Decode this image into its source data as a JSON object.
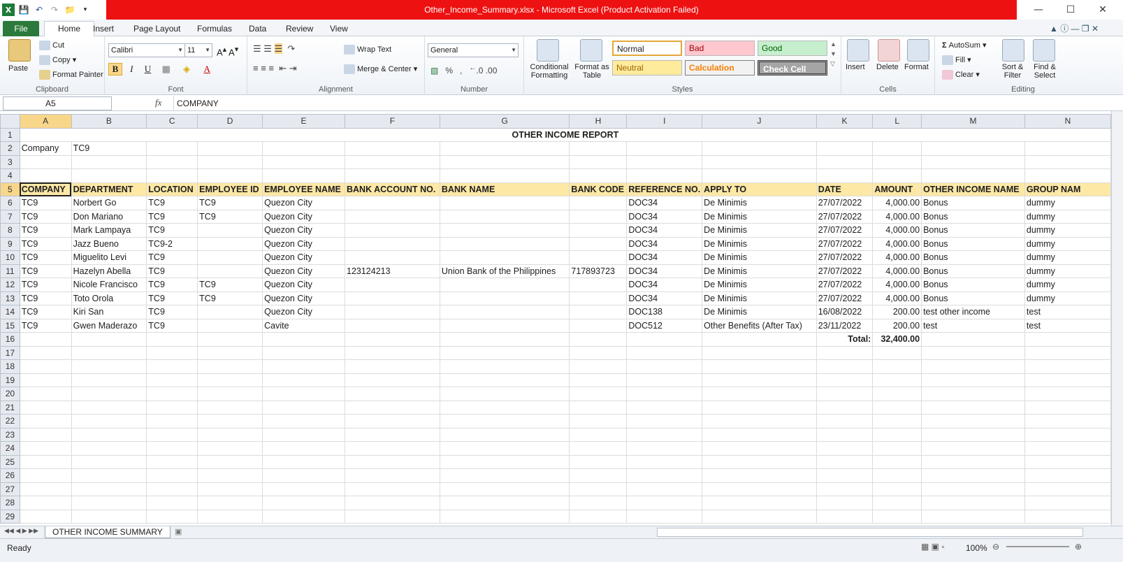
{
  "window": {
    "title": "Other_Income_Summary.xlsx - Microsoft Excel (Product Activation Failed)"
  },
  "tabs": [
    "File",
    "Home",
    "Insert",
    "Page Layout",
    "Formulas",
    "Data",
    "Review",
    "View"
  ],
  "ribbon": {
    "clipboard": {
      "paste": "Paste",
      "cut": "Cut",
      "copy": "Copy",
      "format_painter": "Format Painter",
      "label": "Clipboard"
    },
    "font": {
      "name": "Calibri",
      "size": "11",
      "label": "Font"
    },
    "alignment": {
      "wrap": "Wrap Text",
      "merge": "Merge & Center",
      "label": "Alignment"
    },
    "number": {
      "format": "General",
      "label": "Number"
    },
    "styles": {
      "cond": "Conditional Formatting",
      "fmt_table": "Format as Table",
      "normal": "Normal",
      "bad": "Bad",
      "good": "Good",
      "neutral": "Neutral",
      "calculation": "Calculation",
      "check": "Check Cell",
      "label": "Styles"
    },
    "cells": {
      "insert": "Insert",
      "delete": "Delete",
      "format": "Format",
      "label": "Cells"
    },
    "editing": {
      "autosum": "AutoSum",
      "fill": "Fill",
      "clear": "Clear",
      "sort": "Sort & Filter",
      "find": "Find & Select",
      "label": "Editing"
    }
  },
  "formula_bar": {
    "cell_ref": "A5",
    "fx": "fx",
    "content": "COMPANY"
  },
  "columns": [
    "A",
    "B",
    "C",
    "D",
    "E",
    "F",
    "G",
    "H",
    "I",
    "J",
    "K",
    "L",
    "M",
    "N"
  ],
  "sheet": {
    "report_title": "OTHER INCOME REPORT",
    "company_label": "Company",
    "company_value": "TC9",
    "headers": [
      "COMPANY",
      "DEPARTMENT",
      "LOCATION",
      "EMPLOYEE ID",
      "EMPLOYEE NAME",
      "BANK ACCOUNT NO.",
      "BANK NAME",
      "BANK CODE",
      "REFERENCE NO.",
      "APPLY TO",
      "DATE",
      "AMOUNT",
      "OTHER INCOME NAME",
      "GROUP NAM"
    ],
    "rows": [
      [
        "TC9",
        "Norbert Go",
        "TC9",
        "TC9",
        "Quezon City",
        "",
        "",
        "",
        "DOC34",
        "De Minimis",
        "27/07/2022",
        "4,000.00",
        "Bonus",
        "dummy"
      ],
      [
        "TC9",
        "Don Mariano",
        "TC9",
        "TC9",
        "Quezon City",
        "",
        "",
        "",
        "DOC34",
        "De Minimis",
        "27/07/2022",
        "4,000.00",
        "Bonus",
        "dummy"
      ],
      [
        "TC9",
        "Mark Lampaya",
        "TC9",
        "",
        "Quezon City",
        "",
        "",
        "",
        "DOC34",
        "De Minimis",
        "27/07/2022",
        "4,000.00",
        "Bonus",
        "dummy"
      ],
      [
        "TC9",
        "Jazz Bueno",
        "TC9-2",
        "",
        "Quezon City",
        "",
        "",
        "",
        "DOC34",
        "De Minimis",
        "27/07/2022",
        "4,000.00",
        "Bonus",
        "dummy"
      ],
      [
        "TC9",
        "Miguelito Levi",
        "TC9",
        "",
        "Quezon City",
        "",
        "",
        "",
        "DOC34",
        "De Minimis",
        "27/07/2022",
        "4,000.00",
        "Bonus",
        "dummy"
      ],
      [
        "TC9",
        "Hazelyn Abella",
        "TC9",
        "",
        "Quezon City",
        "123124213",
        "Union Bank of the Philippines",
        "717893723",
        "DOC34",
        "De Minimis",
        "27/07/2022",
        "4,000.00",
        "Bonus",
        "dummy"
      ],
      [
        "TC9",
        "Nicole Francisco",
        "TC9",
        "TC9",
        "Quezon City",
        "",
        "",
        "",
        "DOC34",
        "De Minimis",
        "27/07/2022",
        "4,000.00",
        "Bonus",
        "dummy"
      ],
      [
        "TC9",
        "Toto Orola",
        "TC9",
        "TC9",
        "Quezon City",
        "",
        "",
        "",
        "DOC34",
        "De Minimis",
        "27/07/2022",
        "4,000.00",
        "Bonus",
        "dummy"
      ],
      [
        "TC9",
        "Kiri San",
        "TC9",
        "",
        "Quezon City",
        "",
        "",
        "",
        "DOC138",
        "De Minimis",
        "16/08/2022",
        "200.00",
        "test other income",
        "test"
      ],
      [
        "TC9",
        "Gwen Maderazo",
        "TC9",
        "",
        "Cavite",
        "",
        "",
        "",
        "DOC512",
        "Other Benefits (After Tax)",
        "23/11/2022",
        "200.00",
        "test",
        "test"
      ]
    ],
    "total_label": "Total:",
    "total_value": "32,400.00"
  },
  "sheet_tab": "OTHER INCOME SUMMARY",
  "status": {
    "ready": "Ready",
    "zoom": "100%"
  }
}
